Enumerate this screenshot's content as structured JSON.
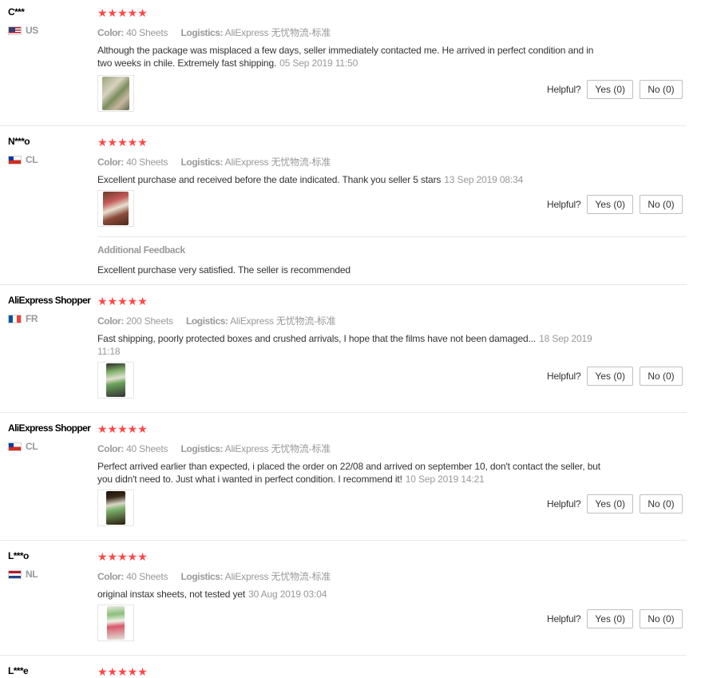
{
  "labels": {
    "color": "Color:",
    "logistics": "Logistics:",
    "helpful": "Helpful?",
    "additional_feedback": "Additional Feedback"
  },
  "colors": {
    "star": "#ff4747",
    "muted": "#999999",
    "text": "#333333",
    "border": "#e8e8e8"
  },
  "reviews": [
    {
      "name": "C***",
      "country": "US",
      "flag_icon": "us-flag-icon",
      "stars": "★★★★★",
      "rating": 5,
      "color": "40 Sheets",
      "logistics": "AliExpress 无忧物流-标准",
      "text": "Although the package was misplaced a few days, seller immediately contacted me. He arrived in perfect condition and in two weeks in chile. Extremely fast shipping.",
      "date": "05 Sep 2019 11:50",
      "yes": "Yes (0)",
      "no": "No (0)"
    },
    {
      "name": "N***o",
      "country": "CL",
      "flag_icon": "cl-flag-icon",
      "stars": "★★★★★",
      "rating": 5,
      "color": "40 Sheets",
      "logistics": "AliExpress 无忧物流-标准",
      "text": "Excellent purchase and received before the date indicated. Thank you seller 5 stars",
      "date": "13 Sep 2019 08:34",
      "yes": "Yes (0)",
      "no": "No (0)",
      "additional": "Excellent purchase very satisfied. The seller is recommended"
    },
    {
      "name": "AliExpress Shopper",
      "country": "FR",
      "flag_icon": "fr-flag-icon",
      "stars": "★★★★★",
      "rating": 5,
      "color": "200 Sheets",
      "logistics": "AliExpress 无忧物流-标准",
      "text": "Fast shipping, poorly protected boxes and crushed arrivals, I hope that the films have not been damaged...",
      "date": "18 Sep 2019 11:18",
      "yes": "Yes (0)",
      "no": "No (0)"
    },
    {
      "name": "AliExpress Shopper",
      "country": "CL",
      "flag_icon": "cl-flag-icon",
      "stars": "★★★★★",
      "rating": 5,
      "color": "40 Sheets",
      "logistics": "AliExpress 无忧物流-标准",
      "text": "Perfect arrived earlier than expected, i placed the order on 22/08 and arrived on september 10, don't contact the seller, but you didn't need to. Just what i wanted in perfect condition. I recommend it!",
      "date": "10 Sep 2019 14:21",
      "yes": "Yes (0)",
      "no": "No (0)"
    },
    {
      "name": "L***o",
      "country": "NL",
      "flag_icon": "nl-flag-icon",
      "stars": "★★★★★",
      "rating": 5,
      "color": "40 Sheets",
      "logistics": "AliExpress 无忧物流-标准",
      "text": "original instax sheets, not tested yet",
      "date": "30 Aug 2019 03:04",
      "yes": "Yes (0)",
      "no": "No (0)"
    },
    {
      "name": "L***e",
      "stars": "★★★★★",
      "rating": 5
    }
  ]
}
